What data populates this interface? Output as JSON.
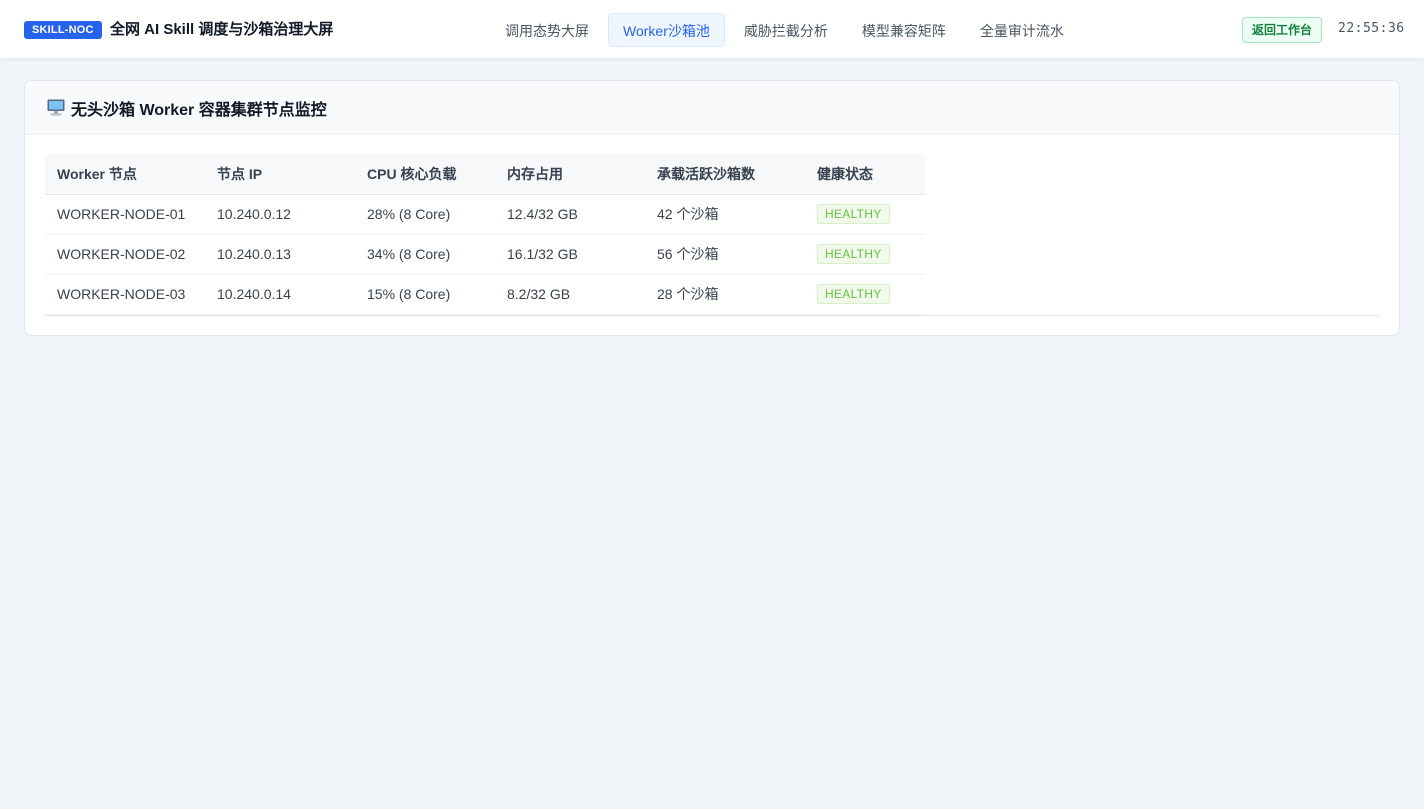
{
  "header": {
    "badge": "SKILL-NOC",
    "title": "全网 AI Skill 调度与沙箱治理大屏",
    "nav": [
      {
        "label": "调用态势大屏",
        "active": false
      },
      {
        "label": "Worker沙箱池",
        "active": true
      },
      {
        "label": "威胁拦截分析",
        "active": false
      },
      {
        "label": "模型兼容矩阵",
        "active": false
      },
      {
        "label": "全量审计流水",
        "active": false
      }
    ],
    "back_button": "返回工作台",
    "clock": "22:55:36"
  },
  "panel": {
    "icon": "monitor-icon",
    "title": "无头沙箱 Worker 容器集群节点监控",
    "columns": [
      "Worker 节点",
      "节点 IP",
      "CPU 核心负载",
      "内存占用",
      "承载活跃沙箱数",
      "健康状态"
    ],
    "rows": [
      [
        "WORKER-NODE-01",
        "10.240.0.12",
        "28% (8 Core)",
        "12.4/32 GB",
        "42 个沙箱",
        "HEALTHY"
      ],
      [
        "WORKER-NODE-02",
        "10.240.0.13",
        "34% (8 Core)",
        "16.1/32 GB",
        "56 个沙箱",
        "HEALTHY"
      ],
      [
        "WORKER-NODE-03",
        "10.240.0.14",
        "15% (8 Core)",
        "8.2/32 GB",
        "28 个沙箱",
        "HEALTHY"
      ]
    ]
  },
  "colors": {
    "accent": "#2563eb",
    "healthy": "#67c23a",
    "back_button": "#15803d",
    "background": "#f0f3f7"
  }
}
